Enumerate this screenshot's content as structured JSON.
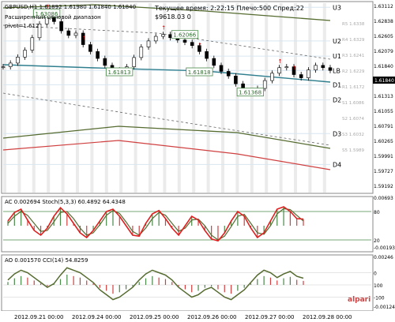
{
  "header": {
    "symbol_line": "GBPUSD,H1  1.61892 1.61980 1.61840 1.61840",
    "indicator_line": "Расширенный ценовой диапазон",
    "pivot_label": "pivot=1.612",
    "time_line": "Текущее время: 2:22:15 Плечо:500 Спред:22",
    "balance_line": "$9618.03  0"
  },
  "chart_data": [
    {
      "type": "line",
      "panel": "price",
      "series": [
        {
          "name": "price",
          "y": [
            1.6192,
            1.62,
            1.6213,
            1.6228,
            1.6255,
            1.6285,
            1.6308,
            1.629,
            1.627,
            1.626,
            1.6265,
            1.624,
            1.6225,
            1.621,
            1.6195,
            1.6185,
            1.6181,
            1.6192,
            1.6212,
            1.6235,
            1.6248,
            1.6258,
            1.6262,
            1.6255,
            1.625,
            1.6245,
            1.6238,
            1.6225,
            1.621,
            1.6195,
            1.6182,
            1.6172,
            1.6155,
            1.614,
            1.6137,
            1.6145,
            1.6162,
            1.6178,
            1.619,
            1.6192,
            1.6175,
            1.6168,
            1.6185,
            1.6195,
            1.619,
            1.6184
          ]
        }
      ],
      "pivot_levels": [
        {
          "label": "U3",
          "value": 1.6321
        },
        {
          "label": "U2",
          "value": 1.6248
        },
        {
          "label": "U1",
          "value": 1.6215
        },
        {
          "label": "LB",
          "value": 1.6184
        },
        {
          "label": "D1",
          "value": 1.6153
        },
        {
          "label": "D2",
          "value": 1.612
        },
        {
          "label": "D3",
          "value": 1.6047
        },
        {
          "label": "D4",
          "value": 1.598
        }
      ],
      "annotations": [
        {
          "text": "1.63086",
          "x": 6,
          "y": 1.6308
        },
        {
          "text": "1.62066",
          "x": 25,
          "y": 1.6262
        },
        {
          "text": "1.61813",
          "x": 16,
          "y": 1.6181
        },
        {
          "text": "1.61818",
          "x": 27,
          "y": 1.6181
        },
        {
          "text": "1.61368",
          "x": 34,
          "y": 1.6137
        }
      ],
      "price_axis": [
        "1.63112",
        "1.62838",
        "1.62605",
        "1.62079",
        "1.61840",
        "1.61583",
        "1.61313",
        "1.61055",
        "1.60791",
        "1.60265",
        "1.59991",
        "1.59727",
        "1.59192"
      ],
      "right_labels": [
        "R5 1.6338",
        "R4 1.6329",
        "R3 1.6241",
        "R2 1.6229",
        "R1 1.6172",
        "S1 1.6086",
        "S2 1.6074",
        "S3 1.6032",
        "S5 1.5989"
      ],
      "ylim": [
        1.5919,
        1.633
      ],
      "last_price": "1.61840",
      "grid": true
    },
    {
      "type": "line",
      "panel": "stochastic",
      "header": "AC 0.002694  Stoch(5,3,3) 60.4892 64.4348",
      "axis_labels": [
        "0.00693",
        "80",
        "20",
        "-0.00193"
      ],
      "series": [
        {
          "name": "Stoch %K",
          "y": [
            60,
            78,
            85,
            62,
            40,
            30,
            45,
            70,
            88,
            75,
            55,
            35,
            25,
            40,
            60,
            80,
            85,
            70,
            50,
            30,
            28,
            55,
            75,
            82,
            65,
            45,
            30,
            50,
            70,
            62,
            40,
            22,
            18,
            35,
            60,
            80,
            70,
            45,
            25,
            35,
            60,
            85,
            90,
            80,
            65,
            64
          ]
        },
        {
          "name": "Stoch %D",
          "y": [
            55,
            70,
            80,
            72,
            55,
            38,
            40,
            58,
            78,
            80,
            65,
            45,
            30,
            35,
            52,
            72,
            82,
            76,
            58,
            38,
            30,
            45,
            65,
            78,
            72,
            55,
            38,
            45,
            62,
            64,
            50,
            30,
            20,
            28,
            48,
            70,
            74,
            55,
            35,
            32,
            50,
            75,
            86,
            84,
            72,
            60
          ]
        }
      ],
      "ylim": [
        0,
        100
      ]
    },
    {
      "type": "bar",
      "panel": "cci",
      "header": "AO 0.001570  CCI(14) 54.8259",
      "axis_labels": [
        "0.00246",
        "0",
        "100",
        "-100",
        "-0.001246"
      ],
      "series": [
        {
          "name": "CCI",
          "y": [
            40,
            90,
            120,
            100,
            60,
            20,
            -20,
            10,
            80,
            140,
            120,
            100,
            60,
            20,
            -40,
            -80,
            -120,
            -100,
            -60,
            -20,
            40,
            90,
            120,
            100,
            80,
            40,
            -20,
            -60,
            -100,
            -80,
            -40,
            -20,
            -60,
            -100,
            -120,
            -80,
            -40,
            20,
            80,
            120,
            100,
            60,
            90,
            110,
            70,
            55
          ]
        }
      ],
      "ylim": [
        -200,
        200
      ]
    }
  ],
  "time_axis": [
    "2012.09.21 00:00",
    "2012.09.24 00:00",
    "2012.09.25 00:00",
    "2012.09.26 00:00",
    "2012.09.27 00:00",
    "2012.09.28 00:00"
  ],
  "watermark": "alpari"
}
